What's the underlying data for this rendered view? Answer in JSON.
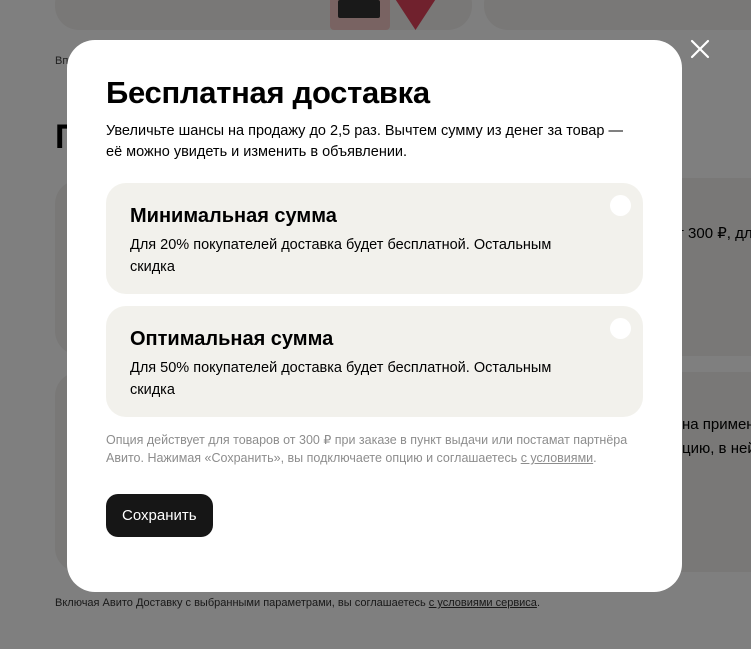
{
  "background": {
    "breadcrumb_text": "Вп",
    "heading_text": "П",
    "right_text_1": "т 300 ₽, дл",
    "right_text_2": "на примен",
    "right_text_3": "цию, в ней",
    "footer_text": "Включая Авито Доставку с выбранными параметрами, вы соглашаетесь ",
    "footer_link": "с условиями сервиса",
    "footer_end": "."
  },
  "modal": {
    "title": "Бесплатная доставка",
    "subtitle": "Увеличьте шансы на продажу до 2,5 раз. Вычтем сумму из денег за товар — её можно увидеть и изменить в объявлении.",
    "options": [
      {
        "title": "Минимальная сумма",
        "description": "Для 20% покупателей доставка будет бесплатной. Остальным скидка",
        "selected": false
      },
      {
        "title": "Оптимальная сумма",
        "description": "Для 50% покупателей доставка будет бесплатной. Остальным скидка",
        "selected": false
      }
    ],
    "note_text": "Опция действует для товаров от 300 ₽ при заказе в пункт выдачи или постамат партнёра Авито. Нажимая «Сохранить», вы подключаете опцию и соглашаетесь ",
    "note_link": "с условиями",
    "note_end": ".",
    "save_label": "Сохранить",
    "close_icon": "close-icon"
  },
  "colors": {
    "overlay": "#00000080",
    "option_bg": "#f2f1ec",
    "button_bg": "#161616",
    "note_text": "#8d8d8d"
  }
}
